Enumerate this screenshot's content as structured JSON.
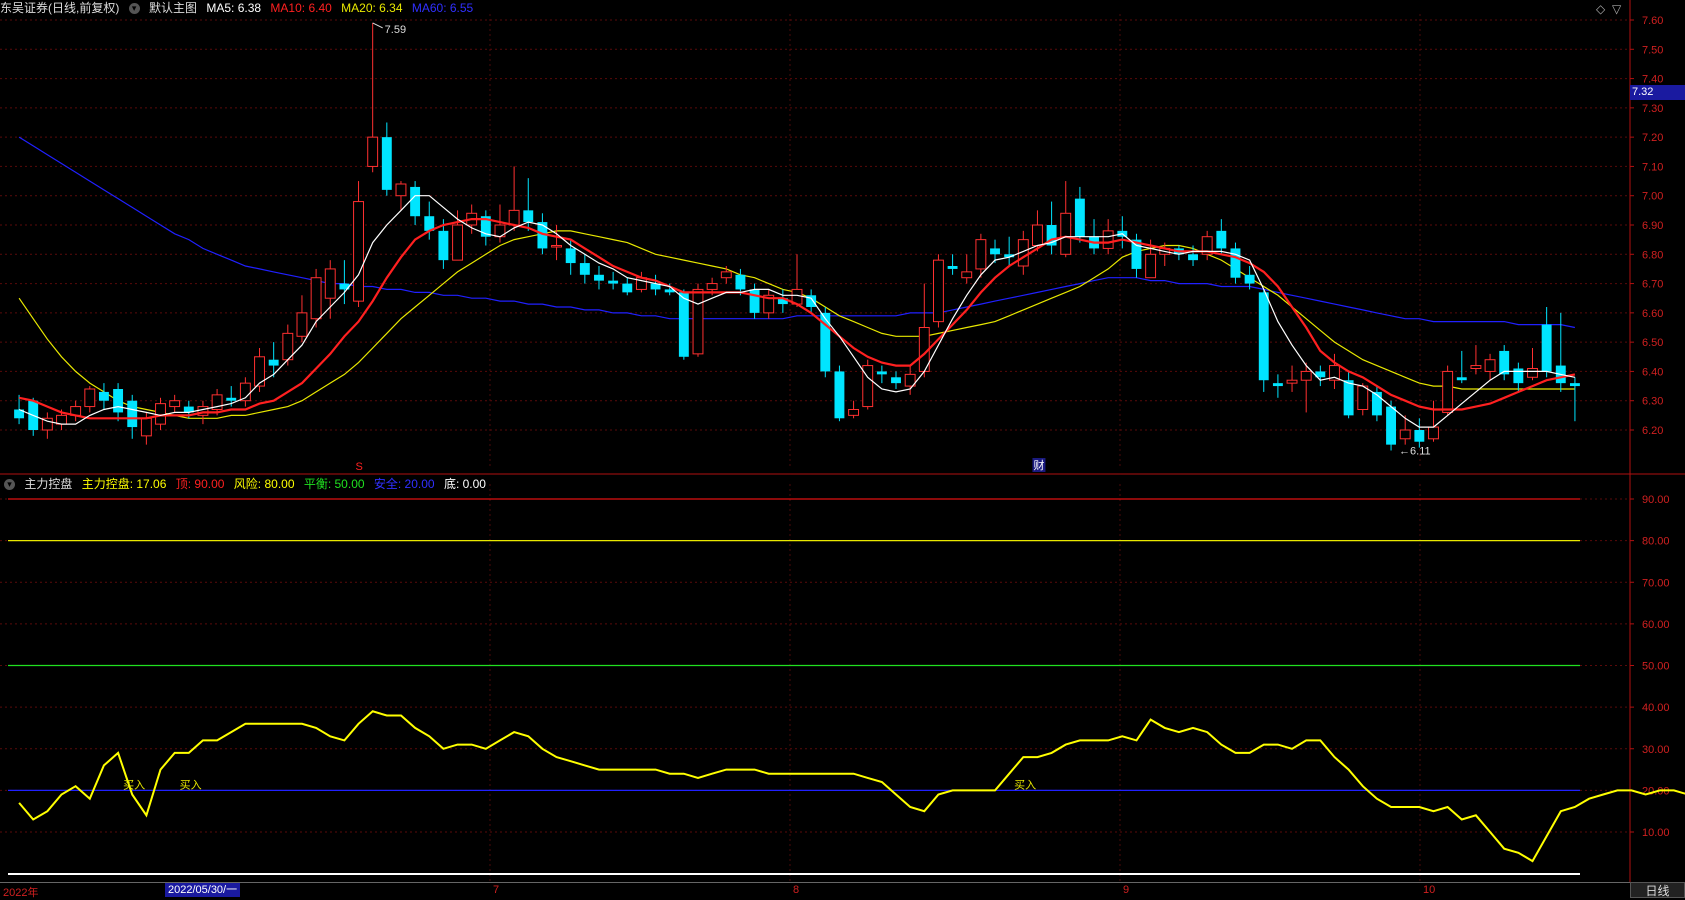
{
  "main_header": {
    "stock": "东吴证券(日线,前复权)",
    "template": "默认主图",
    "ma5": "MA5: 6.38",
    "ma10": "MA10: 6.40",
    "ma20": "MA20: 6.34",
    "ma60": "MA60: 6.55"
  },
  "sub_header": {
    "indicator": "主力控盘",
    "value": "主力控盘: 17.06",
    "top": "顶: 90.00",
    "risk": "风险: 80.00",
    "balance": "平衡: 50.00",
    "safe": "安全: 20.00",
    "bottom": "底: 0.00"
  },
  "price_tag": "7.32",
  "markers": {
    "high": "7.59",
    "low": "6.11",
    "s_mark": "S",
    "cai_mark": "财",
    "buy": "买入"
  },
  "bottom_bar": {
    "year": "2022年",
    "cursor_date": "2022/05/30/一",
    "months": [
      "7",
      "8",
      "9",
      "10"
    ],
    "tab": "日线"
  },
  "colors": {
    "ma5": "#ffffff",
    "ma10": "#ff2020",
    "ma20": "#e8e800",
    "ma60": "#2020ff",
    "up": "#ff3030",
    "down": "#00e5ff"
  },
  "chart_data": [
    {
      "type": "candlestick",
      "title": "东吴证券(日线,前复权)",
      "y_ticks": [
        "7.60",
        "7.50",
        "7.40",
        "7.30",
        "7.20",
        "7.10",
        "7.00",
        "6.90",
        "6.80",
        "6.70",
        "6.60",
        "6.50",
        "6.40",
        "6.30",
        "6.20"
      ],
      "ylim": [
        6.12,
        7.64
      ],
      "candles": [
        [
          6.27,
          6.24,
          6.32,
          6.22
        ],
        [
          6.3,
          6.2,
          6.31,
          6.18
        ],
        [
          6.2,
          6.24,
          6.26,
          6.17
        ],
        [
          6.22,
          6.25,
          6.27,
          6.2
        ],
        [
          6.25,
          6.28,
          6.3,
          6.23
        ],
        [
          6.28,
          6.34,
          6.35,
          6.26
        ],
        [
          6.33,
          6.3,
          6.36,
          6.27
        ],
        [
          6.34,
          6.26,
          6.36,
          6.23
        ],
        [
          6.3,
          6.21,
          6.32,
          6.17
        ],
        [
          6.18,
          6.24,
          6.26,
          6.15
        ],
        [
          6.22,
          6.29,
          6.31,
          6.2
        ],
        [
          6.28,
          6.3,
          6.32,
          6.26
        ],
        [
          6.28,
          6.26,
          6.3,
          6.24
        ],
        [
          6.25,
          6.28,
          6.3,
          6.22
        ],
        [
          6.27,
          6.32,
          6.34,
          6.25
        ],
        [
          6.31,
          6.3,
          6.35,
          6.28
        ],
        [
          6.3,
          6.36,
          6.38,
          6.28
        ],
        [
          6.35,
          6.45,
          6.48,
          6.33
        ],
        [
          6.44,
          6.42,
          6.5,
          6.38
        ],
        [
          6.44,
          6.53,
          6.56,
          6.42
        ],
        [
          6.52,
          6.6,
          6.66,
          6.5
        ],
        [
          6.58,
          6.72,
          6.75,
          6.55
        ],
        [
          6.65,
          6.75,
          6.78,
          6.58
        ],
        [
          6.7,
          6.68,
          6.78,
          6.63
        ],
        [
          6.64,
          6.98,
          7.05,
          6.62
        ],
        [
          7.1,
          7.2,
          7.59,
          7.08
        ],
        [
          7.2,
          7.02,
          7.25,
          7.0
        ],
        [
          7.0,
          7.04,
          7.05,
          6.95
        ],
        [
          7.03,
          6.93,
          7.05,
          6.9
        ],
        [
          6.93,
          6.88,
          6.98,
          6.85
        ],
        [
          6.88,
          6.78,
          6.92,
          6.75
        ],
        [
          6.78,
          6.9,
          6.95,
          6.78
        ],
        [
          6.9,
          6.94,
          6.97,
          6.87
        ],
        [
          6.93,
          6.86,
          6.95,
          6.83
        ],
        [
          6.86,
          6.9,
          6.97,
          6.84
        ],
        [
          6.9,
          6.95,
          7.1,
          6.88
        ],
        [
          6.95,
          6.91,
          7.06,
          6.88
        ],
        [
          6.91,
          6.82,
          6.94,
          6.8
        ],
        [
          6.83,
          6.83,
          6.9,
          6.78
        ],
        [
          6.82,
          6.77,
          6.85,
          6.73
        ],
        [
          6.77,
          6.73,
          6.8,
          6.7
        ],
        [
          6.73,
          6.71,
          6.76,
          6.68
        ],
        [
          6.71,
          6.7,
          6.74,
          6.68
        ],
        [
          6.7,
          6.67,
          6.72,
          6.66
        ],
        [
          6.68,
          6.72,
          6.74,
          6.67
        ],
        [
          6.7,
          6.68,
          6.73,
          6.66
        ],
        [
          6.68,
          6.67,
          6.7,
          6.66
        ],
        [
          6.67,
          6.45,
          6.68,
          6.44
        ],
        [
          6.46,
          6.68,
          6.7,
          6.45
        ],
        [
          6.68,
          6.7,
          6.72,
          6.66
        ],
        [
          6.72,
          6.74,
          6.76,
          6.7
        ],
        [
          6.73,
          6.68,
          6.75,
          6.66
        ],
        [
          6.68,
          6.6,
          6.7,
          6.58
        ],
        [
          6.6,
          6.66,
          6.68,
          6.58
        ],
        [
          6.65,
          6.63,
          6.68,
          6.6
        ],
        [
          6.63,
          6.68,
          6.8,
          6.62
        ],
        [
          6.66,
          6.62,
          6.68,
          6.6
        ],
        [
          6.6,
          6.4,
          6.62,
          6.38
        ],
        [
          6.4,
          6.24,
          6.42,
          6.23
        ],
        [
          6.25,
          6.27,
          6.3,
          6.24
        ],
        [
          6.28,
          6.42,
          6.44,
          6.27
        ],
        [
          6.4,
          6.39,
          6.42,
          6.36
        ],
        [
          6.38,
          6.36,
          6.4,
          6.34
        ],
        [
          6.35,
          6.39,
          6.42,
          6.32
        ],
        [
          6.4,
          6.55,
          6.7,
          6.38
        ],
        [
          6.57,
          6.78,
          6.8,
          6.55
        ],
        [
          6.76,
          6.75,
          6.8,
          6.73
        ],
        [
          6.72,
          6.74,
          6.8,
          6.7
        ],
        [
          6.75,
          6.85,
          6.87,
          6.72
        ],
        [
          6.82,
          6.8,
          6.85,
          6.77
        ],
        [
          6.8,
          6.79,
          6.86,
          6.76
        ],
        [
          6.76,
          6.85,
          6.88,
          6.73
        ],
        [
          6.83,
          6.9,
          6.95,
          6.81
        ],
        [
          6.9,
          6.83,
          6.98,
          6.8
        ],
        [
          6.8,
          6.94,
          7.05,
          6.79
        ],
        [
          6.99,
          6.86,
          7.03,
          6.84
        ],
        [
          6.86,
          6.82,
          6.92,
          6.8
        ],
        [
          6.82,
          6.88,
          6.92,
          6.8
        ],
        [
          6.88,
          6.86,
          6.93,
          6.82
        ],
        [
          6.85,
          6.75,
          6.87,
          6.72
        ],
        [
          6.72,
          6.8,
          6.85,
          6.72
        ],
        [
          6.8,
          6.82,
          6.84,
          6.76
        ],
        [
          6.82,
          6.8,
          6.83,
          6.78
        ],
        [
          6.8,
          6.78,
          6.83,
          6.76
        ],
        [
          6.8,
          6.86,
          6.88,
          6.78
        ],
        [
          6.88,
          6.82,
          6.92,
          6.8
        ],
        [
          6.82,
          6.72,
          6.84,
          6.7
        ],
        [
          6.73,
          6.7,
          6.76,
          6.68
        ],
        [
          6.67,
          6.37,
          6.68,
          6.33
        ],
        [
          6.36,
          6.35,
          6.39,
          6.31
        ],
        [
          6.36,
          6.37,
          6.42,
          6.33
        ],
        [
          6.37,
          6.4,
          6.43,
          6.26
        ],
        [
          6.4,
          6.38,
          6.42,
          6.35
        ],
        [
          6.37,
          6.42,
          6.46,
          6.34
        ],
        [
          6.37,
          6.25,
          6.4,
          6.24
        ],
        [
          6.27,
          6.35,
          6.36,
          6.25
        ],
        [
          6.33,
          6.25,
          6.35,
          6.23
        ],
        [
          6.28,
          6.15,
          6.3,
          6.13
        ],
        [
          6.17,
          6.2,
          6.25,
          6.15
        ],
        [
          6.2,
          6.16,
          6.24,
          6.14
        ],
        [
          6.17,
          6.21,
          6.3,
          6.16
        ],
        [
          6.26,
          6.4,
          6.42,
          6.25
        ],
        [
          6.38,
          6.37,
          6.47,
          6.36
        ],
        [
          6.41,
          6.42,
          6.49,
          6.39
        ],
        [
          6.4,
          6.44,
          6.46,
          6.37
        ],
        [
          6.47,
          6.39,
          6.49,
          6.37
        ],
        [
          6.41,
          6.36,
          6.43,
          6.33
        ],
        [
          6.38,
          6.41,
          6.48,
          6.37
        ],
        [
          6.56,
          6.4,
          6.62,
          6.38
        ],
        [
          6.42,
          6.36,
          6.6,
          6.33
        ],
        [
          6.36,
          6.35,
          6.38,
          6.23
        ]
      ],
      "ma5": [
        6.27,
        6.25,
        6.23,
        6.22,
        6.22,
        6.25,
        6.27,
        6.28,
        6.27,
        6.26,
        6.25,
        6.26,
        6.26,
        6.27,
        6.28,
        6.29,
        6.31,
        6.36,
        6.39,
        6.44,
        6.49,
        6.57,
        6.62,
        6.67,
        6.73,
        6.84,
        6.9,
        6.95,
        7.0,
        7.0,
        6.96,
        6.92,
        6.89,
        6.87,
        6.86,
        6.89,
        6.91,
        6.9,
        6.87,
        6.83,
        6.8,
        6.77,
        6.75,
        6.72,
        6.71,
        6.7,
        6.69,
        6.65,
        6.63,
        6.65,
        6.67,
        6.67,
        6.68,
        6.68,
        6.66,
        6.66,
        6.65,
        6.58,
        6.52,
        6.45,
        6.38,
        6.34,
        6.33,
        6.34,
        6.4,
        6.49,
        6.58,
        6.66,
        6.73,
        6.78,
        6.79,
        6.81,
        6.83,
        6.84,
        6.86,
        6.86,
        6.86,
        6.86,
        6.87,
        6.83,
        6.82,
        6.81,
        6.8,
        6.81,
        6.81,
        6.81,
        6.8,
        6.78,
        6.68,
        6.57,
        6.49,
        6.42,
        6.37,
        6.38,
        6.36,
        6.35,
        6.32,
        6.28,
        6.24,
        6.21,
        6.21,
        6.25,
        6.29,
        6.33,
        6.37,
        6.4,
        6.4,
        6.4,
        6.4,
        6.39,
        6.38
      ],
      "ma10": [
        6.31,
        6.3,
        6.28,
        6.26,
        6.25,
        6.24,
        6.24,
        6.24,
        6.24,
        6.24,
        6.25,
        6.25,
        6.25,
        6.26,
        6.26,
        6.27,
        6.27,
        6.29,
        6.3,
        6.33,
        6.36,
        6.41,
        6.46,
        6.52,
        6.57,
        6.64,
        6.72,
        6.79,
        6.85,
        6.88,
        6.9,
        6.91,
        6.92,
        6.92,
        6.91,
        6.9,
        6.89,
        6.87,
        6.86,
        6.85,
        6.82,
        6.79,
        6.76,
        6.74,
        6.72,
        6.71,
        6.69,
        6.67,
        6.67,
        6.67,
        6.67,
        6.67,
        6.66,
        6.65,
        6.65,
        6.63,
        6.6,
        6.56,
        6.52,
        6.48,
        6.45,
        6.43,
        6.42,
        6.42,
        6.46,
        6.51,
        6.56,
        6.61,
        6.67,
        6.72,
        6.76,
        6.79,
        6.82,
        6.85,
        6.86,
        6.85,
        6.84,
        6.84,
        6.85,
        6.84,
        6.83,
        6.82,
        6.81,
        6.81,
        6.81,
        6.8,
        6.79,
        6.77,
        6.74,
        6.69,
        6.62,
        6.55,
        6.47,
        6.43,
        6.4,
        6.38,
        6.35,
        6.32,
        6.3,
        6.28,
        6.27,
        6.27,
        6.27,
        6.28,
        6.29,
        6.31,
        6.33,
        6.35,
        6.37,
        6.38,
        6.39
      ],
      "ma20": [
        6.65,
        6.58,
        6.51,
        6.45,
        6.4,
        6.36,
        6.33,
        6.3,
        6.28,
        6.27,
        6.26,
        6.25,
        6.24,
        6.24,
        6.24,
        6.25,
        6.25,
        6.26,
        6.27,
        6.28,
        6.3,
        6.33,
        6.36,
        6.39,
        6.43,
        6.48,
        6.53,
        6.58,
        6.62,
        6.66,
        6.7,
        6.74,
        6.77,
        6.8,
        6.83,
        6.85,
        6.86,
        6.87,
        6.88,
        6.88,
        6.87,
        6.86,
        6.85,
        6.84,
        6.82,
        6.8,
        6.79,
        6.78,
        6.77,
        6.76,
        6.75,
        6.73,
        6.72,
        6.7,
        6.68,
        6.67,
        6.65,
        6.62,
        6.59,
        6.57,
        6.55,
        6.53,
        6.52,
        6.52,
        6.52,
        6.53,
        6.54,
        6.55,
        6.56,
        6.57,
        6.59,
        6.61,
        6.63,
        6.65,
        6.67,
        6.69,
        6.72,
        6.75,
        6.79,
        6.81,
        6.82,
        6.83,
        6.83,
        6.82,
        6.8,
        6.78,
        6.75,
        6.72,
        6.69,
        6.66,
        6.62,
        6.58,
        6.54,
        6.5,
        6.47,
        6.44,
        6.42,
        6.4,
        6.38,
        6.36,
        6.35,
        6.35,
        6.34,
        6.34,
        6.34,
        6.34,
        6.34,
        6.34,
        6.34,
        6.34,
        6.34
      ],
      "ma60": [
        7.2,
        7.17,
        7.14,
        7.11,
        7.08,
        7.05,
        7.02,
        6.99,
        6.96,
        6.93,
        6.9,
        6.87,
        6.85,
        6.82,
        6.8,
        6.78,
        6.76,
        6.75,
        6.74,
        6.73,
        6.72,
        6.71,
        6.7,
        6.7,
        6.69,
        6.69,
        6.68,
        6.68,
        6.67,
        6.67,
        6.66,
        6.66,
        6.65,
        6.65,
        6.64,
        6.64,
        6.63,
        6.63,
        6.62,
        6.62,
        6.61,
        6.61,
        6.6,
        6.6,
        6.59,
        6.59,
        6.58,
        6.58,
        6.58,
        6.58,
        6.58,
        6.58,
        6.58,
        6.58,
        6.58,
        6.59,
        6.59,
        6.59,
        6.59,
        6.59,
        6.59,
        6.59,
        6.59,
        6.6,
        6.6,
        6.6,
        6.61,
        6.62,
        6.63,
        6.64,
        6.65,
        6.66,
        6.67,
        6.68,
        6.69,
        6.7,
        6.71,
        6.72,
        6.72,
        6.72,
        6.71,
        6.71,
        6.7,
        6.7,
        6.7,
        6.69,
        6.69,
        6.69,
        6.68,
        6.67,
        6.66,
        6.65,
        6.64,
        6.63,
        6.62,
        6.61,
        6.6,
        6.59,
        6.58,
        6.58,
        6.57,
        6.57,
        6.57,
        6.57,
        6.57,
        6.57,
        6.56,
        6.56,
        6.56,
        6.56,
        6.55
      ]
    },
    {
      "type": "line",
      "title": "主力控盘",
      "y_ticks": [
        "90.00",
        "80.00",
        "70.00",
        "60.00",
        "50.00",
        "40.00",
        "30.00",
        "20.00",
        "10.00"
      ],
      "ylim": [
        0,
        95
      ],
      "levels": [
        90,
        80,
        50,
        20,
        0
      ],
      "values": [
        17,
        13,
        15,
        19,
        21,
        18,
        26,
        29,
        19,
        14,
        25,
        29,
        29,
        32,
        32,
        34,
        36,
        36,
        36,
        36,
        36,
        35,
        33,
        32,
        36,
        39,
        38,
        38,
        35,
        33,
        30,
        31,
        31,
        30,
        32,
        34,
        33,
        30,
        28,
        27,
        26,
        25,
        25,
        25,
        25,
        25,
        24,
        24,
        23,
        24,
        25,
        25,
        25,
        24,
        24,
        24,
        24,
        24,
        24,
        24,
        23,
        22,
        19,
        16,
        15,
        19,
        20,
        20,
        20,
        20,
        24,
        28,
        28,
        29,
        31,
        32,
        32,
        32,
        33,
        32,
        37,
        35,
        34,
        35,
        34,
        31,
        29,
        29,
        31,
        31,
        30,
        32,
        32,
        28,
        25,
        21,
        18,
        16,
        16,
        16,
        15,
        16,
        13,
        14,
        10,
        6,
        5,
        3,
        9,
        15,
        16,
        18,
        19,
        20,
        20,
        19,
        20,
        20,
        19,
        17,
        17
      ],
      "buy_signal_indices": [
        7,
        11,
        70
      ]
    }
  ]
}
